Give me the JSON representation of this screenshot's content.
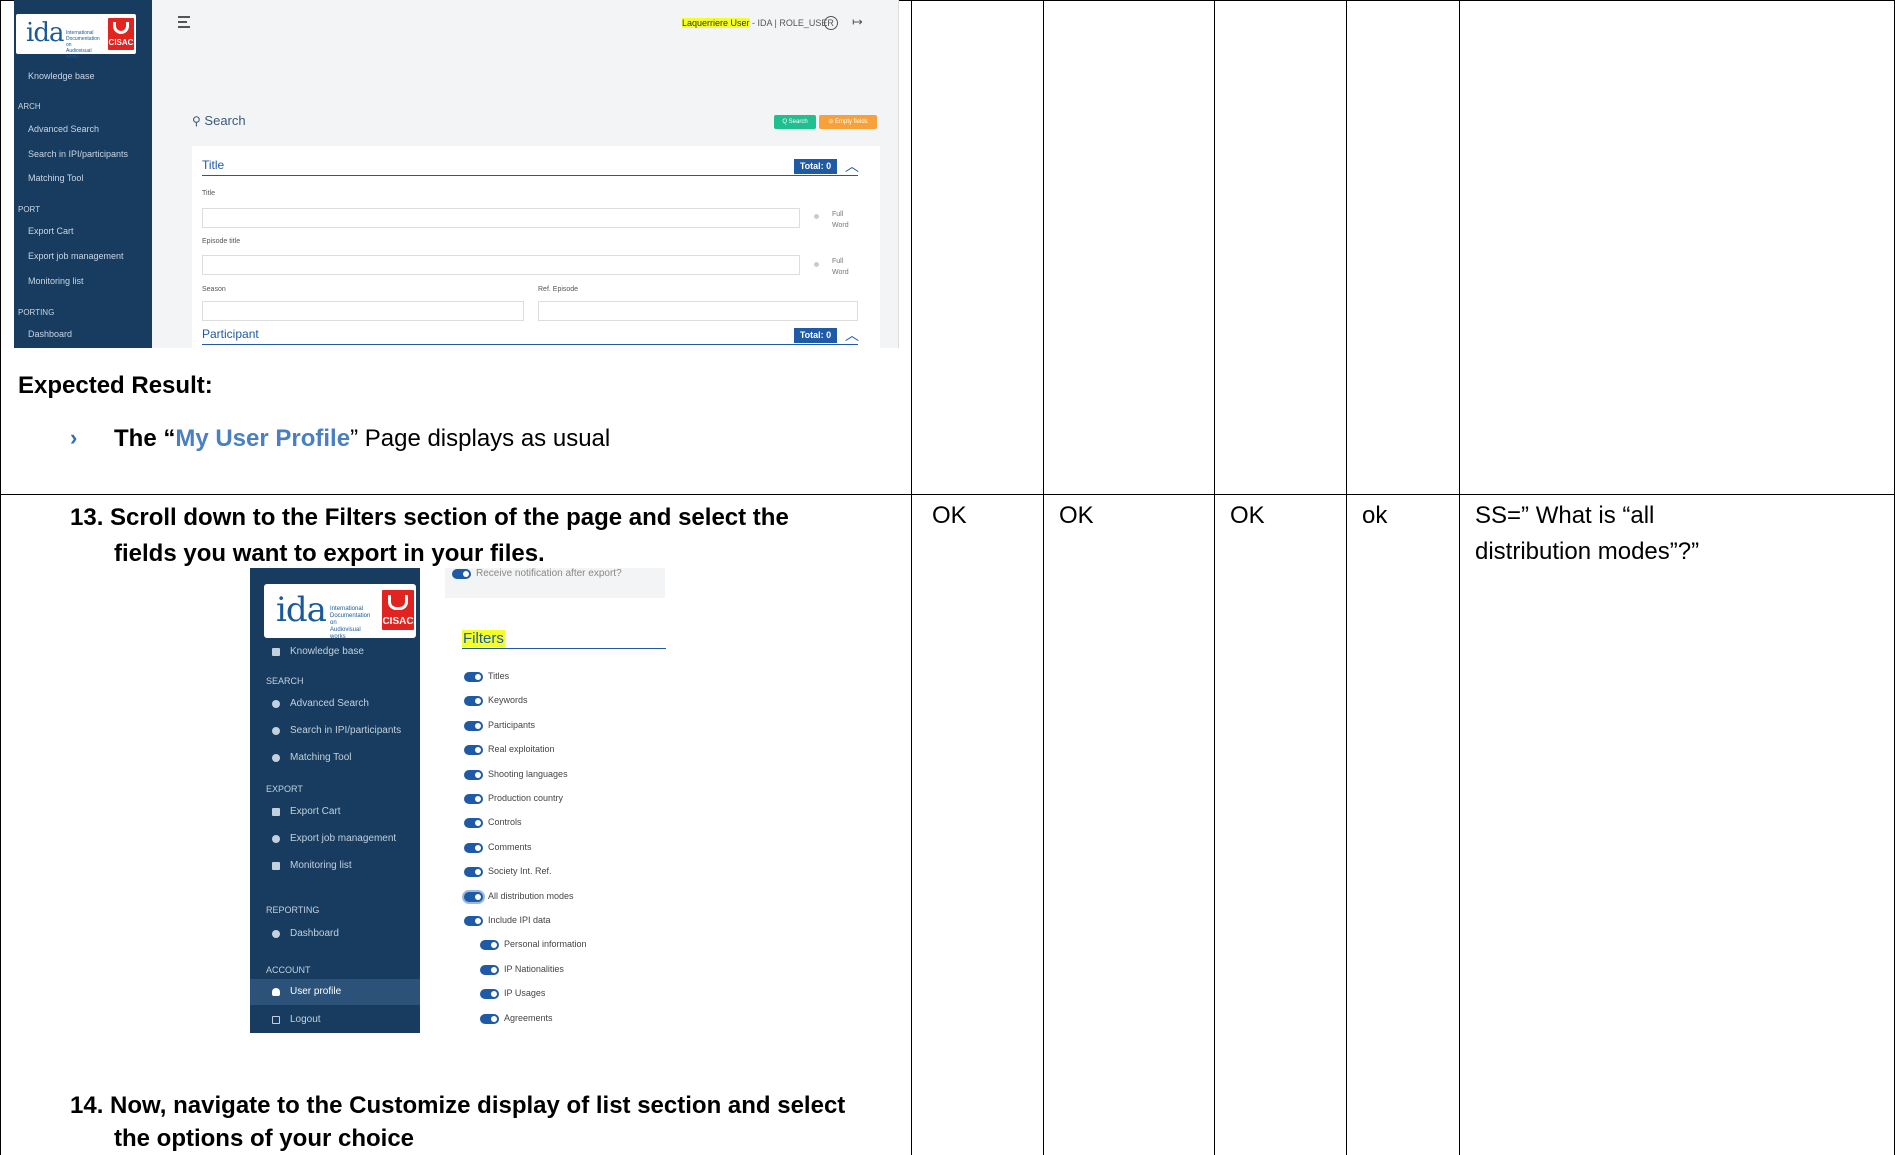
{
  "shot1": {
    "nav_items": [
      {
        "label": "Knowledge base"
      },
      {
        "label": "Advanced Search"
      },
      {
        "label": "Search in IPI/participants"
      },
      {
        "label": "Matching Tool"
      },
      {
        "label": "Export Cart"
      },
      {
        "label": "Export job management"
      },
      {
        "label": "Monitoring list"
      },
      {
        "label": "Dashboard"
      }
    ],
    "sections": [
      "ARCH",
      "PORT",
      "PORTING"
    ],
    "user_highlight": "Laquerriere User",
    "user_rest": " - IDA | ROLE_USER",
    "search_title": "Search",
    "search_button": "Q Search",
    "empty_button": "⊘ Empty fields",
    "title_section": "Title",
    "total_badge": "Total: 0",
    "title_label": "Title",
    "episode_label": "Episode title",
    "full_word": "Full Word",
    "season_label": "Season",
    "ref_episode_label": "Ref. Episode",
    "participant_section": "Participant",
    "total_badge_2": "Total: 0"
  },
  "expected_label": "Expected Result:",
  "expected_pre": "The “",
  "expected_link": "My User Profile",
  "expected_post": "” Page displays as usual",
  "bullet": "›",
  "step13_line1": "13. Scroll down to the Filters section of the page and select the",
  "step13_line2": "fields you want to export in your files.",
  "step14_line1": "14. Now, navigate to the Customize display of list section and select",
  "step14_line2": "the options of your choice",
  "results": [
    "OK",
    "OK",
    "OK",
    "ok"
  ],
  "comment_line1": "SS=” What is “all",
  "comment_line2": "distribution modes”?”",
  "shot2": {
    "top_cut": "Receive notification after export?",
    "nav": {
      "knowledge": "Knowledge base",
      "search_sec": "SEARCH",
      "adv": "Advanced Search",
      "ipi": "Search in IPI/participants",
      "match": "Matching Tool",
      "export_sec": "EXPORT",
      "cart": "Export Cart",
      "jobs": "Export job management",
      "monitor": "Monitoring list",
      "report_sec": "REPORTING",
      "dash": "Dashboard",
      "account_sec": "ACCOUNT",
      "profile": "User profile",
      "logout": "Logout"
    },
    "filters_title": "Filters",
    "filters": [
      "Titles",
      "Keywords",
      "Participants",
      "Real exploitation",
      "Shooting languages",
      "Production country",
      "Controls",
      "Comments",
      "Society Int. Ref.",
      "All distribution modes",
      "Include IPI data"
    ],
    "sub_filters": [
      "Personal information",
      "IP Nationalities",
      "IP Usages",
      "Agreements"
    ]
  }
}
